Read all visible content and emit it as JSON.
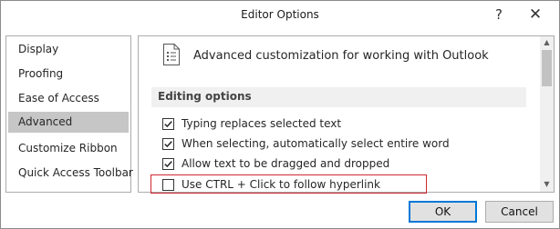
{
  "window": {
    "title": "Editor Options",
    "help_icon": "?",
    "close_icon": "✕"
  },
  "sidebar": {
    "items": [
      {
        "label": "Display",
        "selected": false
      },
      {
        "label": "Proofing",
        "selected": false
      },
      {
        "label": "Ease of Access",
        "selected": false
      },
      {
        "label": "Advanced",
        "selected": true
      },
      {
        "label": "Customize Ribbon",
        "selected": false
      },
      {
        "label": "Quick Access Toolbar",
        "selected": false
      }
    ]
  },
  "content": {
    "header": {
      "icon": "document-list-icon",
      "text": "Advanced customization for working with Outlook"
    },
    "section": {
      "title": "Editing options"
    },
    "options": [
      {
        "label": "Typing replaces selected text",
        "checked": true
      },
      {
        "label": "When selecting, automatically select entire word",
        "checked": true
      },
      {
        "label": "Allow text to be dragged and dropped",
        "checked": true
      },
      {
        "label": "Use CTRL + Click to follow hyperlink",
        "checked": false,
        "highlighted": true
      }
    ]
  },
  "buttons": {
    "ok": "OK",
    "cancel": "Cancel"
  },
  "colors": {
    "selected_nav": "#c6c6c6",
    "highlight_border": "#d0282e",
    "ok_border": "#0078d7"
  }
}
